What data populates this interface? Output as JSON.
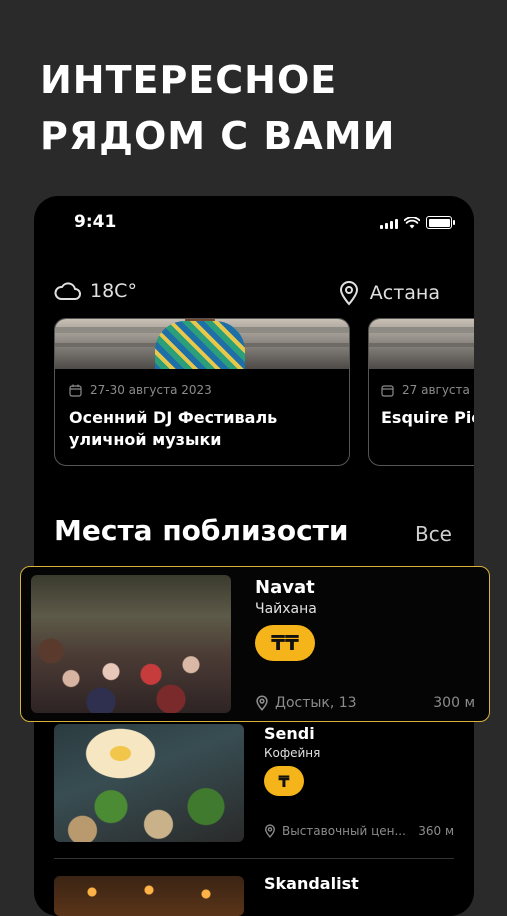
{
  "headline": {
    "line1": "ИНТЕРЕСНОЕ",
    "line2": "РЯДОМ С ВАМИ"
  },
  "status_bar": {
    "time": "9:41"
  },
  "weather": {
    "temperature": "18C°",
    "icon": "cloud-icon"
  },
  "location": {
    "city": "Астана",
    "icon": "location-pin-icon"
  },
  "events": [
    {
      "date": "27-30 августа 2023",
      "title": "Осенний DJ Фестиваль уличной музыки"
    },
    {
      "date": "27 августа",
      "title": "Esquire Picnic"
    }
  ],
  "nearby": {
    "title": "Места поблизости",
    "see_all": "Все",
    "places": [
      {
        "name": "Navat",
        "type": "Чайхана",
        "price": "₸₸",
        "address": "Достык, 13",
        "distance": "300 м"
      },
      {
        "name": "Sendi",
        "type": "Кофейня",
        "price": "₸",
        "address": "Выставочный цен...",
        "distance": "360 м"
      },
      {
        "name": "Skandalist",
        "type": "",
        "price": "",
        "address": "",
        "distance": ""
      }
    ]
  },
  "colors": {
    "accent": "#f4b41a",
    "highlight_border": "#d8b23a",
    "background": "#2a2a2a",
    "card_bg": "#000000"
  }
}
